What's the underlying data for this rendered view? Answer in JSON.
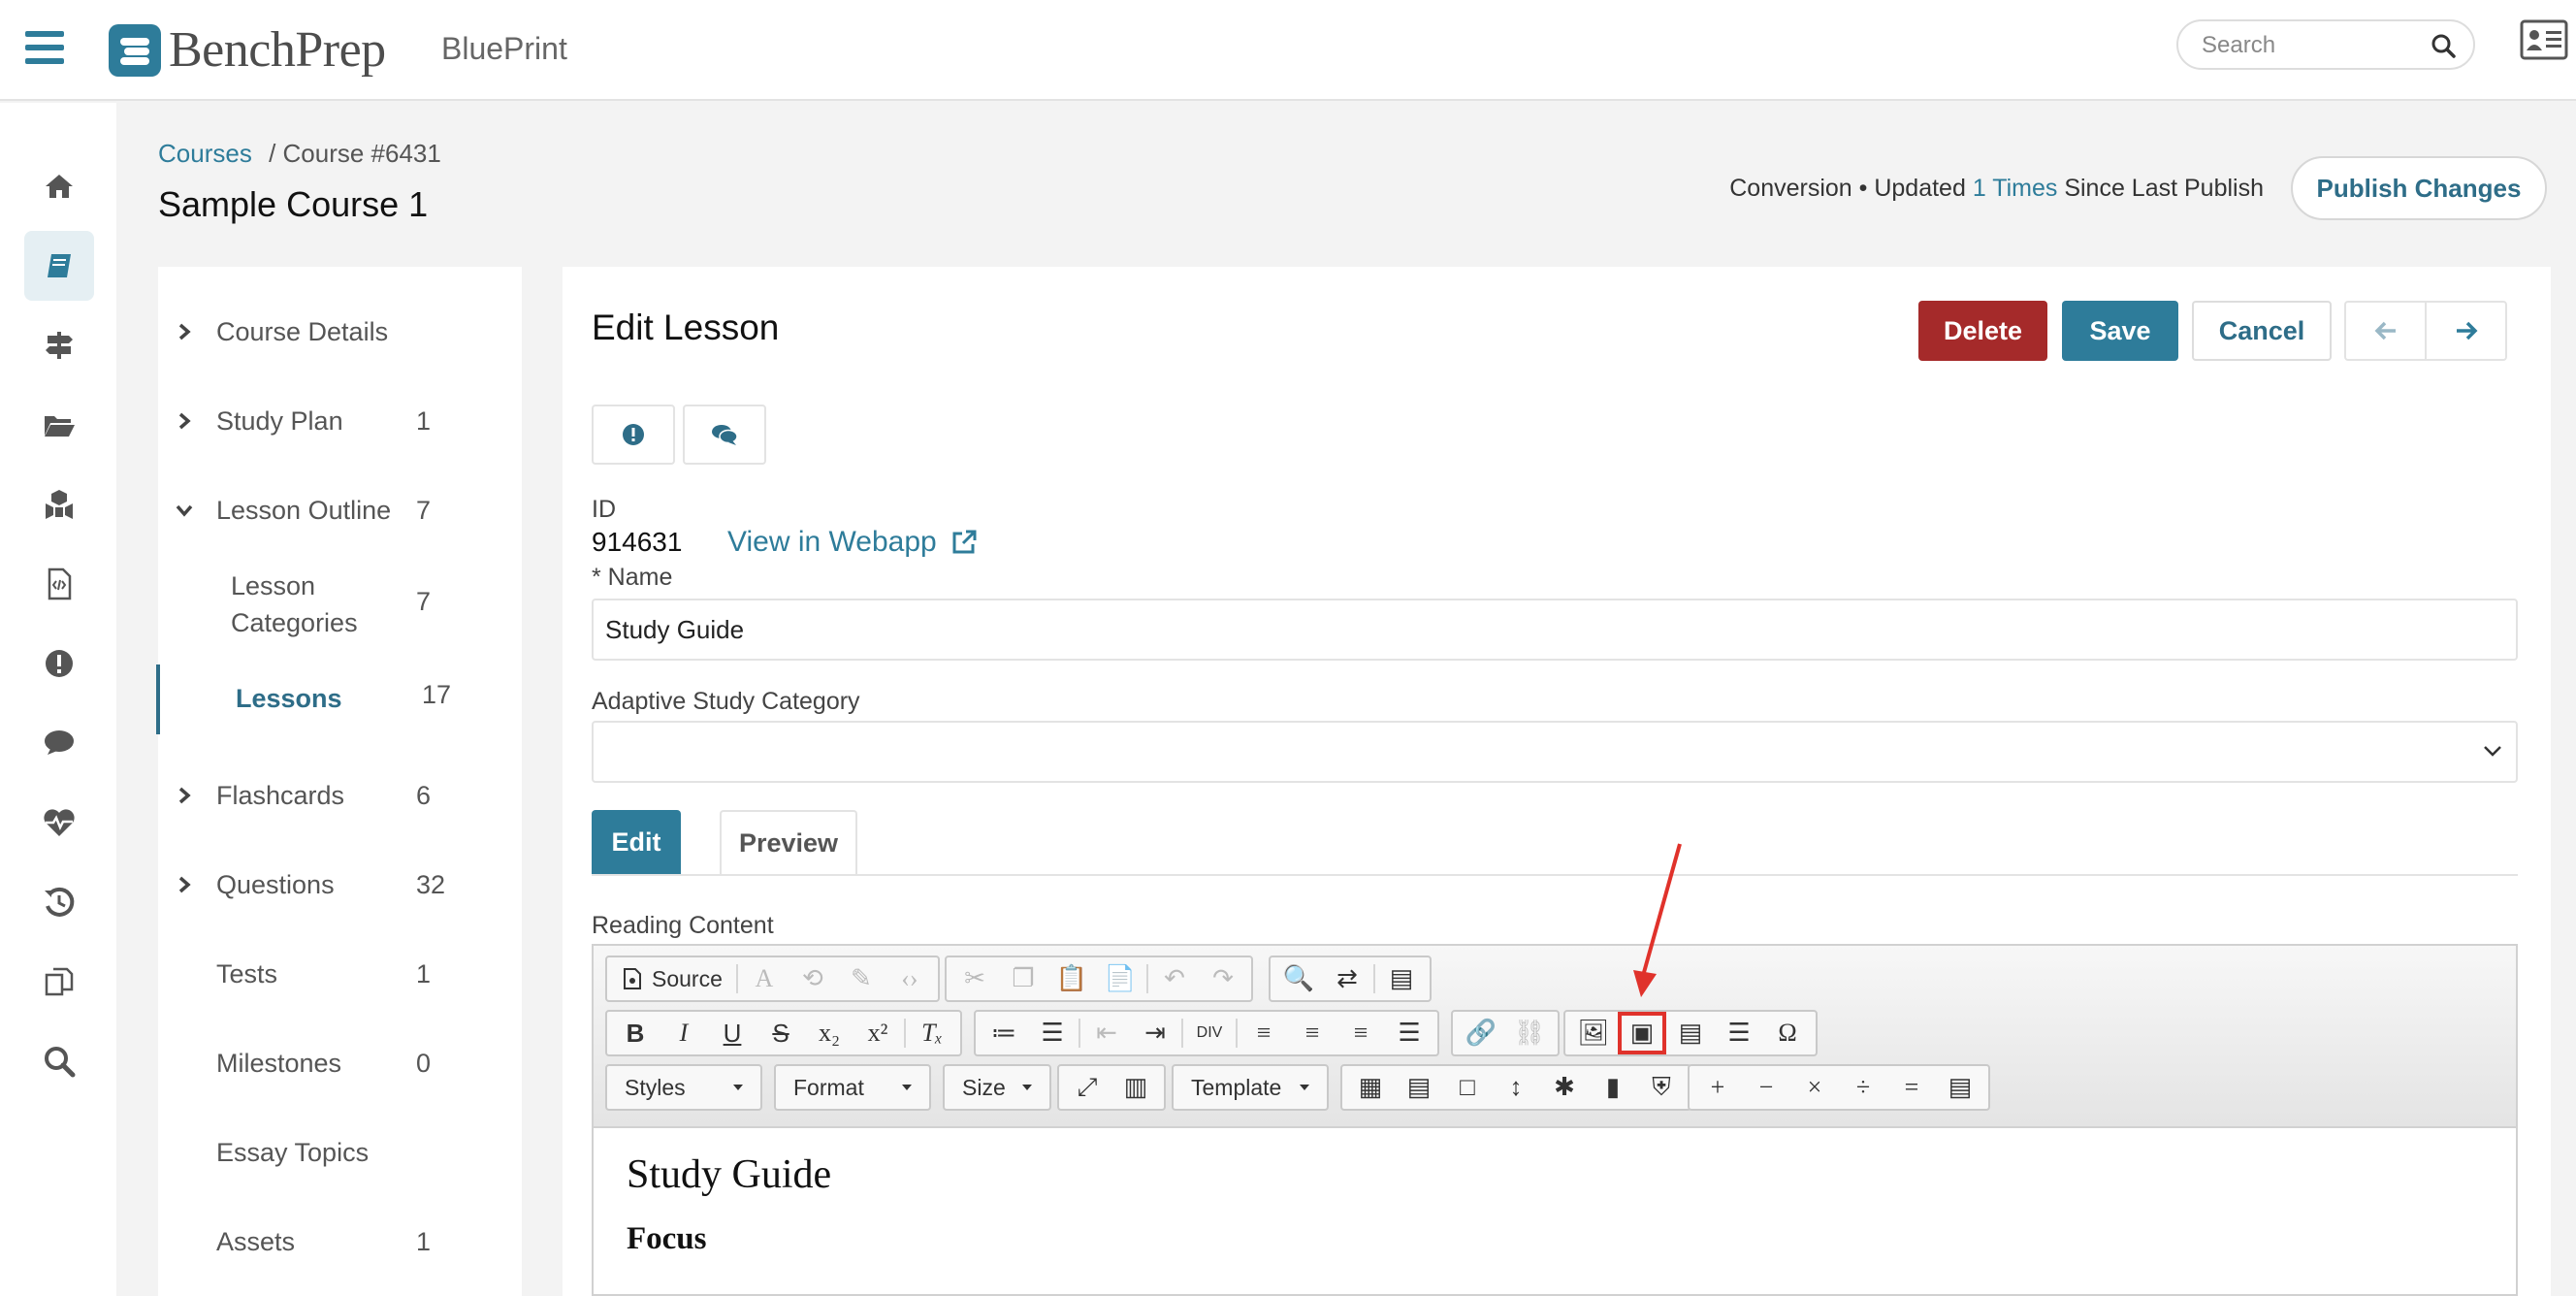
{
  "topbar": {
    "brand": "BenchPrep",
    "app_name": "BluePrint",
    "search_placeholder": "Search"
  },
  "rail": {
    "items": [
      "home-icon",
      "book-icon",
      "signpost-icon",
      "folder-icon",
      "cubes-icon",
      "file-code-icon",
      "alert-icon",
      "comment-icon",
      "heartbeat-icon",
      "history-icon",
      "copy-icon",
      "search-icon"
    ],
    "active": "book-icon"
  },
  "header": {
    "breadcrumb_link": "Courses",
    "breadcrumb_current": "/ Course #6431",
    "course_title": "Sample Course 1",
    "status_prefix": "Conversion • Updated",
    "status_count": "1 Times",
    "status_suffix": "Since Last Publish",
    "publish_label": "Publish Changes"
  },
  "outline": {
    "items": [
      {
        "label": "Course Details",
        "count": ""
      },
      {
        "label": "Study Plan",
        "count": "1"
      },
      {
        "label": "Lesson Outline",
        "count": "7"
      },
      {
        "label": "Lesson Categories",
        "count": "7"
      },
      {
        "label": "Lessons",
        "count": "17"
      },
      {
        "label": "Flashcards",
        "count": "6"
      },
      {
        "label": "Questions",
        "count": "32"
      },
      {
        "label": "Tests",
        "count": "1"
      },
      {
        "label": "Milestones",
        "count": "0"
      },
      {
        "label": "Essay Topics",
        "count": ""
      },
      {
        "label": "Assets",
        "count": "1"
      }
    ]
  },
  "editor": {
    "title": "Edit Lesson",
    "delete_label": "Delete",
    "save_label": "Save",
    "cancel_label": "Cancel",
    "id_label": "ID",
    "id_value": "914631",
    "webapp_link": "View in Webapp",
    "name_label": "* Name",
    "name_value": "Study Guide",
    "category_label": "Adaptive Study Category",
    "category_value": "",
    "tab_edit": "Edit",
    "tab_preview": "Preview",
    "content_label": "Reading Content",
    "toolbar": {
      "source": "Source",
      "styles": "Styles",
      "format": "Format",
      "size": "Size",
      "template": "Template"
    },
    "content": {
      "heading": "Study Guide",
      "subheading": "Focus"
    }
  },
  "colors": {
    "accent": "#2e7c9a",
    "danger": "#a52a2a",
    "highlight": "#e0322b"
  }
}
